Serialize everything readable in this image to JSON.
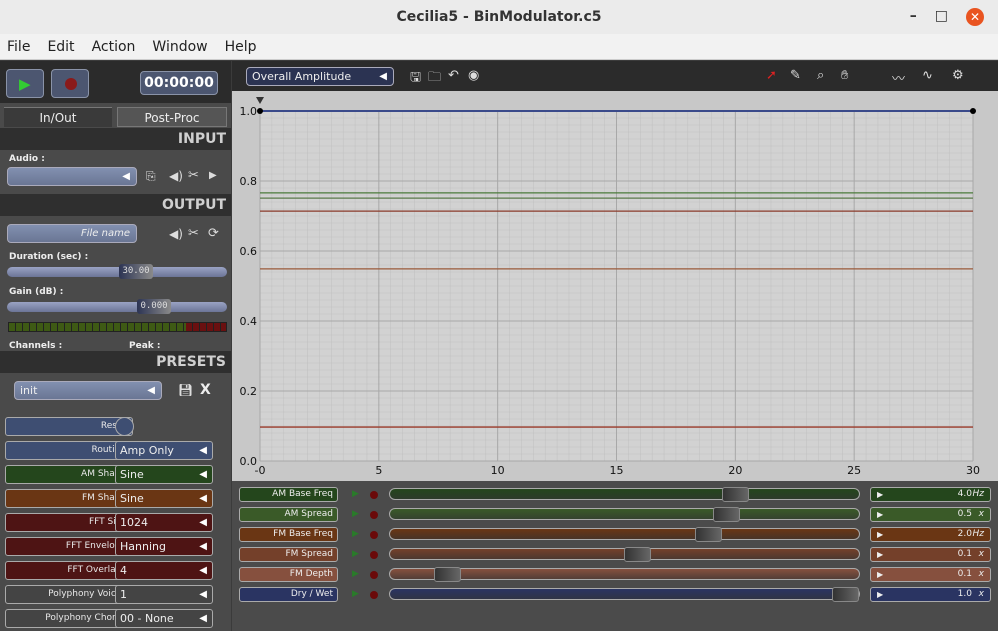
{
  "window": {
    "title": "Cecilia5 - BinModulator.c5",
    "min": "–",
    "max": "□",
    "close": "✕"
  },
  "menu": [
    "File",
    "Edit",
    "Action",
    "Window",
    "Help"
  ],
  "transport": {
    "time": "00:00:00"
  },
  "tabs": [
    "In/Out",
    "Post-Proc"
  ],
  "input": {
    "header": "INPUT",
    "audio_label": "Audio :"
  },
  "output": {
    "header": "OUTPUT",
    "filename_placeholder": "File name",
    "duration_label": "Duration (sec) :",
    "duration": "30.00",
    "duration_fraction": 0.5,
    "gain_label": "Gain (dB) :",
    "gain": "0.000",
    "gain_fraction": 0.75,
    "channels_label": "Channels :",
    "peak_label": "Peak :"
  },
  "presets": {
    "header": "PRESETS",
    "current": "init",
    "delete": "X"
  },
  "params": [
    {
      "label": "Reset",
      "value": null,
      "color": "#3e4e72"
    },
    {
      "label": "Routing",
      "value": "Amp Only",
      "color": "#3e4e72"
    },
    {
      "label": "AM Shape",
      "value": "Sine",
      "color": "#24461c"
    },
    {
      "label": "FM Shape",
      "value": "Sine",
      "color": "#6a3614"
    },
    {
      "label": "FFT Size",
      "value": "1024",
      "color": "#4e1414"
    },
    {
      "label": "FFT Envelope",
      "value": "Hanning",
      "color": "#4e1414"
    },
    {
      "label": "FFT Overlaps",
      "value": "4",
      "color": "#4e1414"
    },
    {
      "label": "Polyphony Voices",
      "value": "1",
      "color": "#444444"
    },
    {
      "label": "Polyphony Chords",
      "value": "00 - None",
      "color": "#444444"
    }
  ],
  "graph": {
    "selector": "Overall Amplitude",
    "x_ticks": [
      "-0",
      "5",
      "10",
      "15",
      "20",
      "25",
      "30"
    ],
    "y_ticks": [
      "0.0",
      "0.2",
      "0.4",
      "0.6",
      "0.8",
      "1.0"
    ],
    "lines": [
      {
        "value": 1.0,
        "color": "#3a4a8a"
      },
      {
        "value": 0.766,
        "color": "#4a7a3a"
      },
      {
        "value": 0.751,
        "color": "#5a7a4a"
      },
      {
        "value": 0.714,
        "color": "#8a3a2a"
      },
      {
        "value": 0.549,
        "color": "#9a5a3a"
      },
      {
        "value": 0.097,
        "color": "#9a3a2a"
      }
    ]
  },
  "sliders": [
    {
      "label": "AM Base Freq",
      "value": "4.0",
      "unit": "Hz",
      "fraction": 0.75,
      "color": "#24461c"
    },
    {
      "label": "AM Spread",
      "value": "0.5",
      "unit": "x",
      "fraction": 0.73,
      "color": "#3a5a28"
    },
    {
      "label": "FM Base Freq",
      "value": "2.0",
      "unit": "Hz",
      "fraction": 0.69,
      "color": "#6a3614"
    },
    {
      "label": "FM Spread",
      "value": "0.1",
      "unit": "x",
      "fraction": 0.53,
      "color": "#74402a"
    },
    {
      "label": "FM Depth",
      "value": "0.1",
      "unit": "x",
      "fraction": 0.1,
      "color": "#86503e"
    },
    {
      "label": "Dry / Wet",
      "value": "1.0",
      "unit": "x",
      "fraction": 1.0,
      "color": "#2a3462"
    }
  ]
}
